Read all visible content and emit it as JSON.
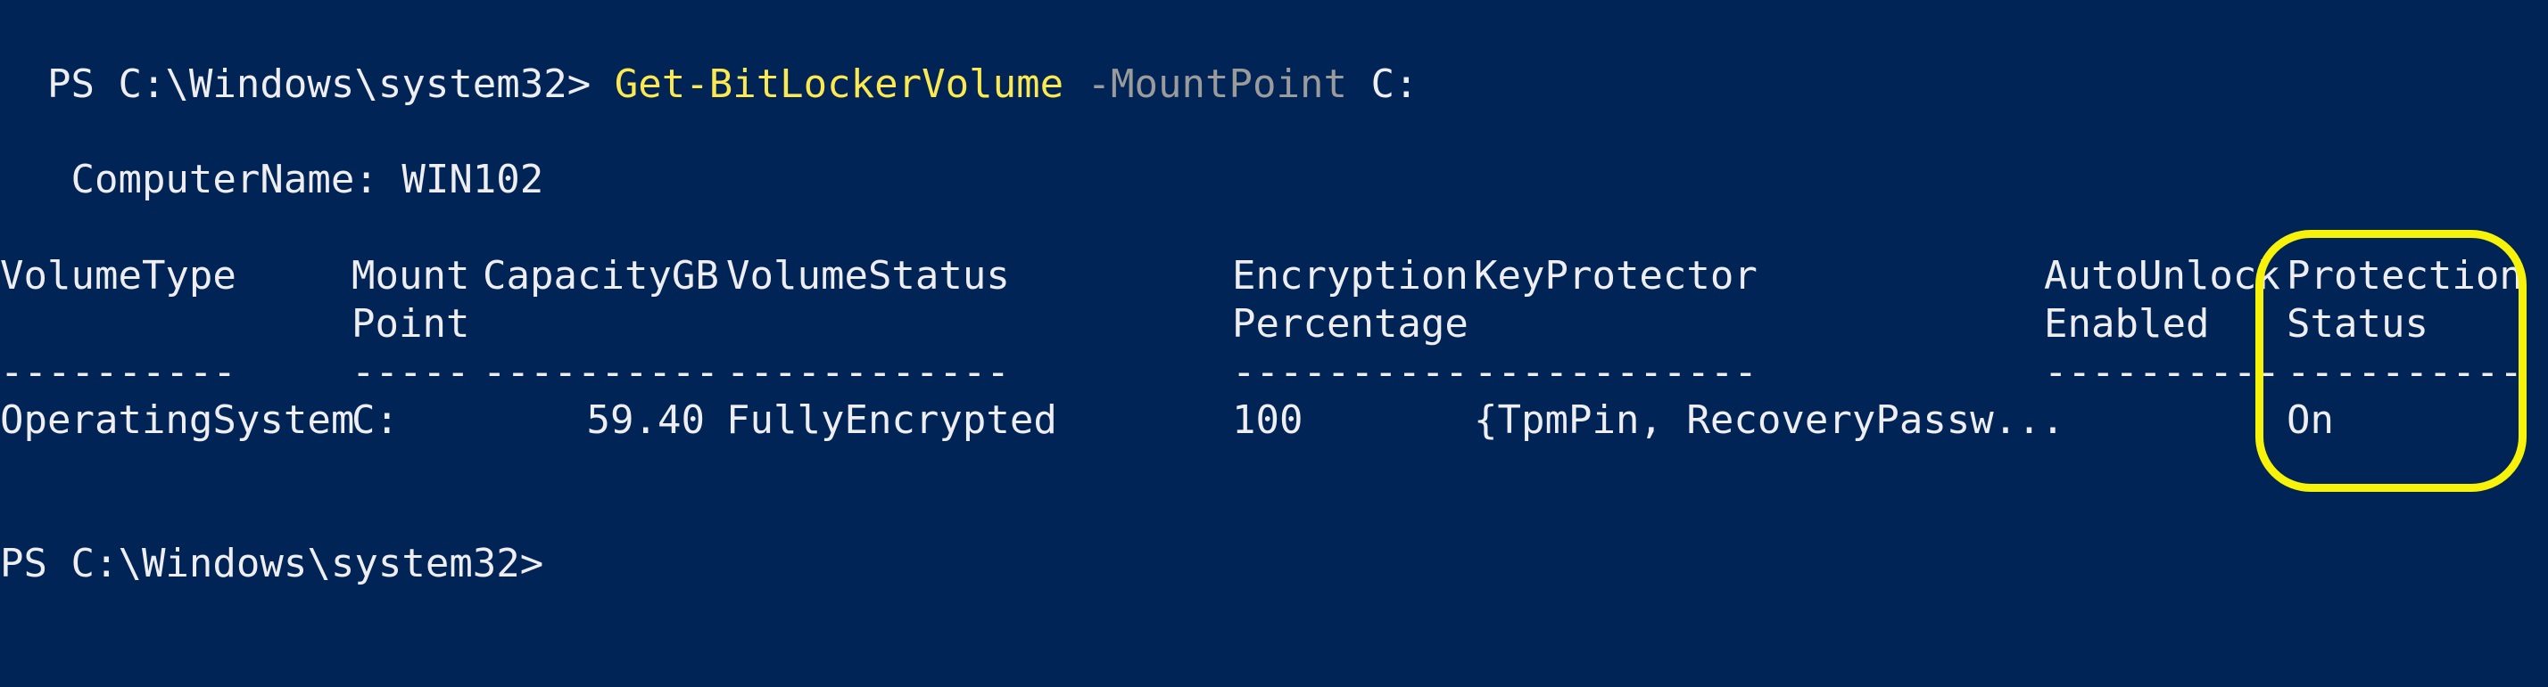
{
  "console": {
    "prompt1": "PS C:\\Windows\\system32> ",
    "command": {
      "cmdlet": "Get-BitLockerVolume",
      "param": " -MountPoint",
      "arg": " C:"
    },
    "computer_name_line": "   ComputerName: WIN102",
    "table": {
      "headers": [
        {
          "line1": "VolumeType",
          "line2": ""
        },
        {
          "line1": "Mount",
          "line2": "Point"
        },
        {
          "line1": "CapacityGB",
          "line2": ""
        },
        {
          "line1": "VolumeStatus",
          "line2": ""
        },
        {
          "line1": "Encryption",
          "line2": "Percentage"
        },
        {
          "line1": "KeyProtector",
          "line2": ""
        },
        {
          "line1": "AutoUnlock",
          "line2": "Enabled"
        },
        {
          "line1": "Protection",
          "line2": "Status"
        }
      ],
      "dashes": [
        "----------",
        "-----",
        "----------",
        "------------",
        "----------",
        "------------",
        "----------",
        "----------"
      ],
      "rows": [
        [
          "OperatingSystem",
          "C:",
          "59.40",
          "FullyEncrypted",
          "100",
          "{TpmPin, RecoveryPassw...",
          "",
          "On"
        ]
      ]
    },
    "prompt2": "PS C:\\Windows\\system32>",
    "highlight_color": "#f7f20a",
    "background_color": "#012456"
  }
}
